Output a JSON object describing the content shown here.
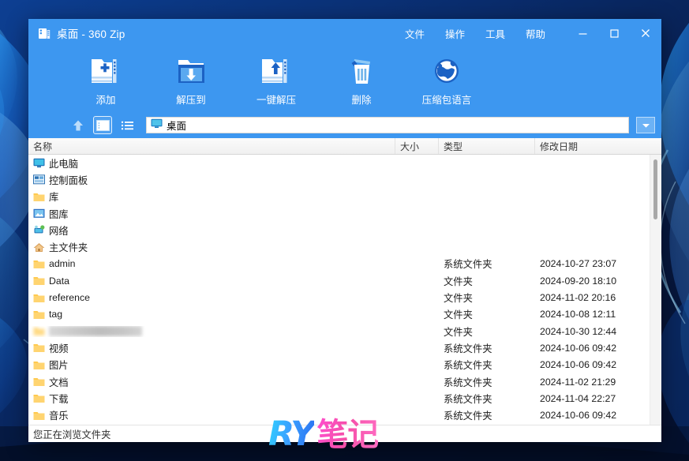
{
  "window": {
    "title": "桌面 - 360 Zip",
    "app_icon": "archive-icon"
  },
  "menu": {
    "items": [
      {
        "label": "文件",
        "name": "menu-file"
      },
      {
        "label": "操作",
        "name": "menu-action"
      },
      {
        "label": "工具",
        "name": "menu-tools"
      },
      {
        "label": "帮助",
        "name": "menu-help"
      }
    ],
    "minimize": "—",
    "maximize": "▢",
    "close": "✕"
  },
  "toolbar": {
    "buttons": [
      {
        "label": "添加",
        "icon": "add-to-archive-icon"
      },
      {
        "label": "解压到",
        "icon": "extract-to-icon"
      },
      {
        "label": "一键解压",
        "icon": "one-click-extract-icon"
      },
      {
        "label": "删除",
        "icon": "delete-trash-icon"
      },
      {
        "label": "压缩包语言",
        "icon": "archive-language-globe-icon"
      }
    ]
  },
  "addressbar": {
    "up_icon": "up-arrow-icon",
    "view_thumbnail_icon": "thumbnail-view-icon",
    "view_list_icon": "list-view-icon",
    "path_icon": "desktop-monitor-icon",
    "path": "桌面",
    "dropdown_icon": "chevron-down-icon"
  },
  "columns": [
    {
      "label": "名称",
      "key": "name"
    },
    {
      "label": "大小",
      "key": "size"
    },
    {
      "label": "类型",
      "key": "type"
    },
    {
      "label": "修改日期",
      "key": "date"
    }
  ],
  "files": [
    {
      "name": "此电脑",
      "icon": "computer-icon",
      "size": "",
      "type": "",
      "date": ""
    },
    {
      "name": "控制面板",
      "icon": "control-panel-icon",
      "size": "",
      "type": "",
      "date": ""
    },
    {
      "name": "库",
      "icon": "folder-icon",
      "size": "",
      "type": "",
      "date": ""
    },
    {
      "name": "图库",
      "icon": "gallery-icon",
      "size": "",
      "type": "",
      "date": ""
    },
    {
      "name": "网络",
      "icon": "network-icon",
      "size": "",
      "type": "",
      "date": ""
    },
    {
      "name": "主文件夹",
      "icon": "home-folder-icon",
      "size": "",
      "type": "",
      "date": ""
    },
    {
      "name": "admin",
      "icon": "folder-icon",
      "size": "",
      "type": "系统文件夹",
      "date": "2024-10-27 23:07"
    },
    {
      "name": "Data",
      "icon": "folder-icon",
      "size": "",
      "type": "文件夹",
      "date": "2024-09-20 18:10"
    },
    {
      "name": "reference",
      "icon": "folder-icon",
      "size": "",
      "type": "文件夹",
      "date": "2024-11-02 20:16"
    },
    {
      "name": "tag",
      "icon": "folder-icon",
      "size": "",
      "type": "文件夹",
      "date": "2024-10-08 12:11"
    },
    {
      "name": "",
      "icon": "folder-icon",
      "size": "",
      "type": "文件夹",
      "date": "2024-10-30 12:44",
      "redacted": true
    },
    {
      "name": "视频",
      "icon": "folder-icon",
      "size": "",
      "type": "系统文件夹",
      "date": "2024-10-06 09:42"
    },
    {
      "name": "图片",
      "icon": "folder-icon",
      "size": "",
      "type": "系统文件夹",
      "date": "2024-10-06 09:42"
    },
    {
      "name": "文档",
      "icon": "folder-icon",
      "size": "",
      "type": "系统文件夹",
      "date": "2024-11-02 21:29"
    },
    {
      "name": "下载",
      "icon": "folder-icon",
      "size": "",
      "type": "系统文件夹",
      "date": "2024-11-04 22:27"
    },
    {
      "name": "音乐",
      "icon": "folder-icon",
      "size": "",
      "type": "系统文件夹",
      "date": "2024-10-06 09:42"
    }
  ],
  "statusbar": {
    "text": "您正在浏览文件夹"
  },
  "watermark": {
    "latin": "RY",
    "cjk": "笔记"
  },
  "colors": {
    "titlebar_blue": "#3d97f0",
    "window_bg": "#ffffff",
    "folder_yellow": "#ffc34d",
    "accent_cyan": "#2fd2ff",
    "accent_pink": "#ff4fd0",
    "wallpaper_dark": "#071636"
  }
}
